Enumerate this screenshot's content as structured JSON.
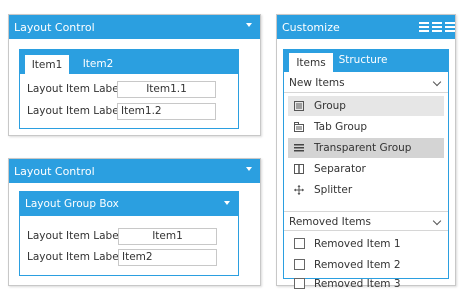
{
  "layout_control_1": {
    "title": "Layout Control",
    "tabs": [
      {
        "label": "Item1"
      },
      {
        "label": "Item2"
      }
    ],
    "rows": [
      {
        "label": "Layout Item Label",
        "value": "Item1.1"
      },
      {
        "label": "Layout Item Label",
        "value": "Item1.2"
      }
    ]
  },
  "layout_control_2": {
    "title": "Layout Control",
    "group_box_title": "Layout Group Box",
    "rows": [
      {
        "label": "Layout Item Label",
        "value": "Item1"
      },
      {
        "label": "Layout Item Label",
        "value": "Item2"
      }
    ]
  },
  "customize": {
    "title": "Customize",
    "tabs": [
      {
        "label": "Items"
      },
      {
        "label": "Structure"
      }
    ],
    "new_items_header": "New Items",
    "new_items": [
      {
        "label": "Group",
        "icon": "group-icon"
      },
      {
        "label": "Tab Group",
        "icon": "tab-group-icon"
      },
      {
        "label": "Transparent Group",
        "icon": "transparent-group-icon"
      },
      {
        "label": "Separator",
        "icon": "separator-icon"
      },
      {
        "label": "Splitter",
        "icon": "splitter-icon"
      }
    ],
    "removed_items_header": "Removed Items",
    "removed_items": [
      {
        "label": "Removed Item 1"
      },
      {
        "label": "Removed Item 2"
      },
      {
        "label": "Removed Item 3"
      }
    ]
  },
  "colors": {
    "accent": "#2b9fe0",
    "selected_light": "#e6e6e6",
    "selected_dark": "#d4d4d4"
  }
}
